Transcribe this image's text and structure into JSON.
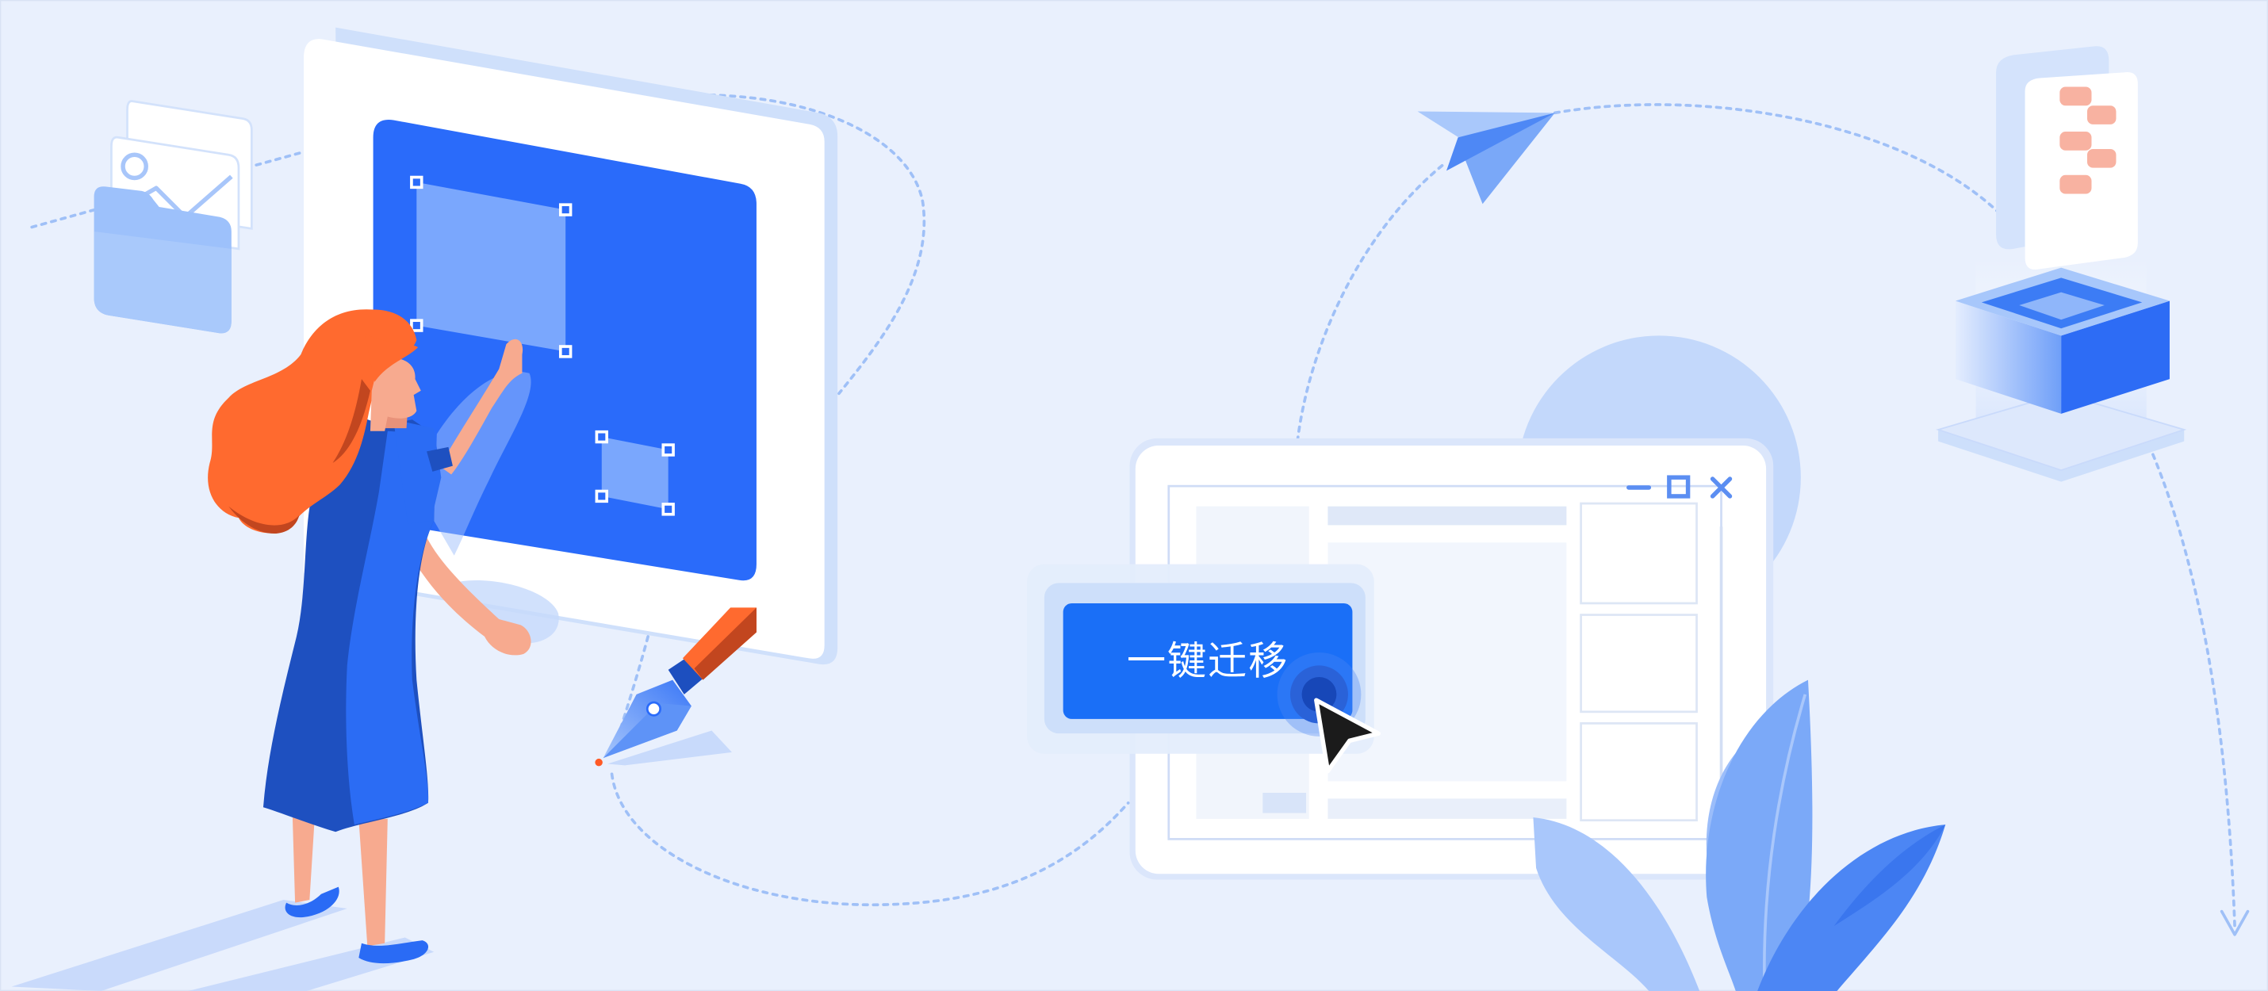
{
  "banner": {
    "background": "#e9f0fd",
    "border": "#d9e3f4"
  },
  "colors": {
    "accent": "#1a6ff7",
    "board_blue": "#2a6bfa",
    "selection_blue": "#7aa7fd",
    "dash_line": "#9fc0f7",
    "hair": "#ff6a2f",
    "skin": "#f7aa8f",
    "salmon": "#f8b2a1"
  },
  "migrate_button": {
    "label": "一键迁移",
    "color": "#1a6ff7"
  },
  "window": {
    "controls": [
      {
        "icon": "minimize-icon"
      },
      {
        "icon": "maximize-icon"
      },
      {
        "icon": "close-icon"
      }
    ]
  },
  "icons": [
    "folder-icon",
    "image-icon",
    "pen-tool-icon",
    "paper-plane-icon",
    "document-icon",
    "server-icon",
    "cursor-icon",
    "plant-icon"
  ]
}
